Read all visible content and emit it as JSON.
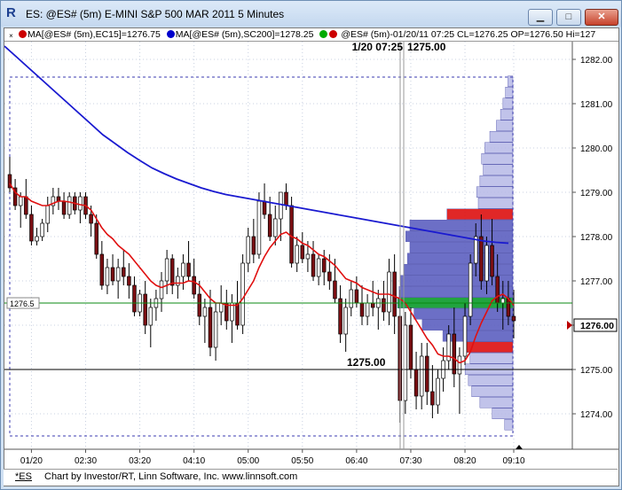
{
  "window": {
    "icon_letter": "R",
    "title": "ES: @ES# (5m) E-MINI S&P 500 MAR 2011 5 Minutes",
    "buttons": {
      "minimize": "▁",
      "maximize": "□",
      "close": "✕"
    }
  },
  "legend": {
    "close_glyph": "×",
    "ma15_text": "MA[@ES# (5m),EC15]=1276.75",
    "ma15_color": "#cc0000",
    "ma200_text": "MA[@ES# (5m),SC200]=1278.25",
    "ma200_color": "#0000cc",
    "bar_text": "@ES# (5m)-01/20/11 07:25 CL=1276.25 OP=1276.50 Hi=127",
    "bar_colors": [
      "#00aa00",
      "#cc0000"
    ]
  },
  "chart_data": {
    "type": "candlestick",
    "x_labels": [
      "01/20",
      "02:30",
      "03:20",
      "04:10",
      "05:00",
      "05:50",
      "06:40",
      "07:30",
      "08:20",
      "09:10"
    ],
    "y_labels": [
      "1282.00",
      "1281.00",
      "1280.00",
      "1279.00",
      "1278.00",
      "1277.00",
      "1276.00",
      "1275.00",
      "1274.00"
    ],
    "ylim": [
      1273.2,
      1282.4
    ],
    "y_ticks": [
      1282,
      1281,
      1280,
      1279,
      1278,
      1277,
      1276,
      1275,
      1274
    ],
    "bars": [
      [
        1279.4,
        1279.8,
        1279.0,
        1279.1
      ],
      [
        1279.1,
        1279.3,
        1278.6,
        1278.7
      ],
      [
        1278.7,
        1279.0,
        1278.2,
        1278.9
      ],
      [
        1278.9,
        1279.3,
        1278.4,
        1278.5
      ],
      [
        1278.5,
        1278.7,
        1277.8,
        1277.9
      ],
      [
        1277.9,
        1278.2,
        1277.8,
        1278.0
      ],
      [
        1278.0,
        1278.4,
        1277.9,
        1278.3
      ],
      [
        1278.3,
        1278.9,
        1278.1,
        1278.7
      ],
      [
        1278.7,
        1279.1,
        1278.5,
        1278.9
      ],
      [
        1278.9,
        1279.1,
        1278.6,
        1278.8
      ],
      [
        1278.8,
        1279.0,
        1278.4,
        1278.5
      ],
      [
        1278.5,
        1279.0,
        1278.4,
        1278.9
      ],
      [
        1278.9,
        1279.0,
        1278.5,
        1278.6
      ],
      [
        1278.6,
        1279.0,
        1278.3,
        1278.9
      ],
      [
        1278.9,
        1279.0,
        1278.4,
        1278.5
      ],
      [
        1278.5,
        1278.7,
        1278.0,
        1278.3
      ],
      [
        1278.3,
        1278.5,
        1277.5,
        1277.6
      ],
      [
        1277.6,
        1277.9,
        1276.8,
        1276.9
      ],
      [
        1276.9,
        1277.5,
        1276.7,
        1277.3
      ],
      [
        1277.3,
        1277.6,
        1276.9,
        1277.0
      ],
      [
        1277.0,
        1277.5,
        1276.6,
        1277.3
      ],
      [
        1277.3,
        1277.7,
        1276.9,
        1277.1
      ],
      [
        1277.1,
        1277.4,
        1276.6,
        1276.9
      ],
      [
        1276.9,
        1277.1,
        1276.2,
        1276.3
      ],
      [
        1276.3,
        1276.8,
        1276.2,
        1276.7
      ],
      [
        1276.7,
        1277.0,
        1275.8,
        1276.0
      ],
      [
        1276.0,
        1276.6,
        1275.5,
        1276.4
      ],
      [
        1276.4,
        1276.8,
        1276.1,
        1276.6
      ],
      [
        1276.6,
        1277.2,
        1276.3,
        1277.0
      ],
      [
        1277.0,
        1277.7,
        1276.7,
        1277.5
      ],
      [
        1277.5,
        1277.6,
        1276.7,
        1276.9
      ],
      [
        1276.9,
        1277.3,
        1276.6,
        1277.1
      ],
      [
        1277.1,
        1277.6,
        1276.8,
        1277.4
      ],
      [
        1277.4,
        1277.9,
        1277.0,
        1277.1
      ],
      [
        1277.1,
        1277.5,
        1276.6,
        1276.7
      ],
      [
        1276.7,
        1277.0,
        1276.0,
        1276.2
      ],
      [
        1276.2,
        1276.6,
        1275.6,
        1276.4
      ],
      [
        1276.4,
        1276.8,
        1275.3,
        1275.5
      ],
      [
        1275.5,
        1276.5,
        1275.2,
        1276.3
      ],
      [
        1276.3,
        1276.9,
        1276.0,
        1276.5
      ],
      [
        1276.5,
        1276.8,
        1275.9,
        1276.1
      ],
      [
        1276.1,
        1276.7,
        1275.6,
        1276.5
      ],
      [
        1276.5,
        1277.0,
        1275.9,
        1276.0
      ],
      [
        1276.0,
        1277.6,
        1275.8,
        1277.4
      ],
      [
        1277.4,
        1278.2,
        1277.2,
        1278.0
      ],
      [
        1278.0,
        1278.4,
        1277.4,
        1277.6
      ],
      [
        1277.6,
        1279.0,
        1277.5,
        1278.8
      ],
      [
        1278.8,
        1279.2,
        1278.4,
        1278.5
      ],
      [
        1278.5,
        1278.9,
        1277.9,
        1278.0
      ],
      [
        1278.0,
        1278.7,
        1277.8,
        1278.4
      ],
      [
        1278.4,
        1279.0,
        1277.9,
        1279.0
      ],
      [
        1279.0,
        1279.2,
        1278.6,
        1278.7
      ],
      [
        1278.7,
        1278.9,
        1277.3,
        1277.4
      ],
      [
        1277.4,
        1278.0,
        1277.2,
        1277.8
      ],
      [
        1277.8,
        1278.1,
        1277.4,
        1277.5
      ],
      [
        1277.5,
        1277.9,
        1277.2,
        1277.6
      ],
      [
        1277.6,
        1277.9,
        1277.0,
        1277.1
      ],
      [
        1277.1,
        1277.6,
        1276.9,
        1277.5
      ],
      [
        1277.5,
        1277.7,
        1276.9,
        1277.2
      ],
      [
        1277.2,
        1277.6,
        1276.8,
        1277.0
      ],
      [
        1277.0,
        1277.5,
        1276.5,
        1276.6
      ],
      [
        1276.6,
        1276.9,
        1275.6,
        1275.8
      ],
      [
        1275.8,
        1276.6,
        1275.4,
        1276.4
      ],
      [
        1276.4,
        1277.0,
        1276.2,
        1276.8
      ],
      [
        1276.8,
        1277.1,
        1276.4,
        1276.5
      ],
      [
        1276.5,
        1276.9,
        1276.0,
        1276.2
      ],
      [
        1276.2,
        1276.7,
        1276.0,
        1276.5
      ],
      [
        1276.5,
        1277.0,
        1276.2,
        1276.4
      ],
      [
        1276.4,
        1276.8,
        1275.9,
        1276.6
      ],
      [
        1276.6,
        1277.0,
        1276.1,
        1276.3
      ],
      [
        1276.3,
        1277.5,
        1276.0,
        1277.2
      ],
      [
        1277.2,
        1277.6,
        1275.8,
        1276.2
      ],
      [
        1276.2,
        1276.8,
        1273.8,
        1274.3
      ],
      [
        1274.3,
        1276.3,
        1274.0,
        1276.0
      ],
      [
        1276.0,
        1276.4,
        1274.8,
        1275.0
      ],
      [
        1275.0,
        1275.4,
        1274.1,
        1274.4
      ],
      [
        1274.4,
        1275.6,
        1274.1,
        1275.3
      ],
      [
        1275.3,
        1275.6,
        1274.2,
        1274.5
      ],
      [
        1274.5,
        1275.1,
        1273.9,
        1274.2
      ],
      [
        1274.2,
        1275.0,
        1274.0,
        1274.8
      ],
      [
        1274.8,
        1275.5,
        1274.5,
        1275.2
      ],
      [
        1275.2,
        1276.0,
        1275.0,
        1275.8
      ],
      [
        1275.8,
        1276.4,
        1274.6,
        1274.9
      ],
      [
        1274.9,
        1275.5,
        1274.0,
        1275.3
      ],
      [
        1275.3,
        1276.5,
        1275.1,
        1276.2
      ],
      [
        1276.2,
        1277.6,
        1276.0,
        1277.4
      ],
      [
        1277.4,
        1278.3,
        1277.1,
        1278.0
      ],
      [
        1278.0,
        1278.5,
        1276.8,
        1277.0
      ],
      [
        1277.0,
        1278.0,
        1276.7,
        1277.8
      ],
      [
        1277.8,
        1278.4,
        1276.9,
        1277.1
      ],
      [
        1277.1,
        1277.6,
        1276.3,
        1276.5
      ],
      [
        1276.5,
        1277.0,
        1275.9,
        1276.6
      ],
      [
        1276.6,
        1277.0,
        1276.0,
        1276.2
      ],
      [
        1276.2,
        1276.8,
        1275.7,
        1276.1
      ]
    ],
    "volume_profile": [
      [
        1281.5,
        6
      ],
      [
        1281.25,
        9
      ],
      [
        1281.0,
        12
      ],
      [
        1280.75,
        15
      ],
      [
        1280.5,
        20
      ],
      [
        1280.25,
        28
      ],
      [
        1280.0,
        34
      ],
      [
        1279.75,
        38
      ],
      [
        1279.5,
        36
      ],
      [
        1279.25,
        40
      ],
      [
        1279.0,
        44
      ],
      [
        1278.75,
        42
      ],
      [
        1278.5,
        80
      ],
      [
        1278.25,
        125
      ],
      [
        1278.0,
        130
      ],
      [
        1277.75,
        125
      ],
      [
        1277.5,
        128
      ],
      [
        1277.25,
        132
      ],
      [
        1277.0,
        136
      ],
      [
        1276.75,
        138
      ],
      [
        1276.5,
        140
      ],
      [
        1276.25,
        120
      ],
      [
        1276.0,
        110
      ],
      [
        1275.75,
        85
      ],
      [
        1275.5,
        60
      ],
      [
        1275.25,
        52
      ],
      [
        1275.0,
        58
      ],
      [
        1274.75,
        54
      ],
      [
        1274.5,
        50
      ],
      [
        1274.25,
        40
      ],
      [
        1274.0,
        25
      ],
      [
        1273.75,
        10
      ]
    ],
    "profile_poc": 1276.5,
    "profile_hi_nodes": [
      1278.5,
      1275.5
    ],
    "ma15": [
      1279.2,
      1279.0,
      1278.9,
      1278.9,
      1278.8,
      1278.75,
      1278.7,
      1278.7,
      1278.75,
      1278.8,
      1278.8,
      1278.78,
      1278.75,
      1278.72,
      1278.7,
      1278.6,
      1278.4,
      1278.2,
      1278.05,
      1277.95,
      1277.8,
      1277.7,
      1277.6,
      1277.45,
      1277.3,
      1277.15,
      1277.0,
      1276.9,
      1276.85,
      1276.9,
      1276.95,
      1276.95,
      1276.95,
      1277.0,
      1276.98,
      1276.9,
      1276.75,
      1276.6,
      1276.5,
      1276.5,
      1276.45,
      1276.45,
      1276.45,
      1276.6,
      1276.8,
      1277.0,
      1277.3,
      1277.55,
      1277.75,
      1277.9,
      1278.05,
      1278.1,
      1278.0,
      1277.95,
      1277.85,
      1277.8,
      1277.7,
      1277.6,
      1277.55,
      1277.45,
      1277.35,
      1277.2,
      1277.05,
      1277.0,
      1276.95,
      1276.85,
      1276.8,
      1276.75,
      1276.7,
      1276.7,
      1276.7,
      1276.65,
      1276.6,
      1276.5,
      1276.3,
      1276.1,
      1275.9,
      1275.7,
      1275.55,
      1275.35,
      1275.3,
      1275.3,
      1275.25,
      1275.15,
      1275.2,
      1275.4,
      1275.75,
      1276.05,
      1276.3,
      1276.55,
      1276.65,
      1276.7,
      1276.6,
      1276.45
    ],
    "ma200": [
      1282.3,
      1282.05,
      1281.8,
      1281.55,
      1281.3,
      1281.05,
      1280.8,
      1280.55,
      1280.3,
      1280.1,
      1279.9,
      1279.72,
      1279.55,
      1279.42,
      1279.3,
      1279.2,
      1279.1,
      1279.02,
      1278.95,
      1278.9,
      1278.85,
      1278.8,
      1278.75,
      1278.7,
      1278.65,
      1278.6,
      1278.55,
      1278.5,
      1278.45,
      1278.4,
      1278.35,
      1278.3,
      1278.25,
      1278.2,
      1278.15,
      1278.1,
      1278.05,
      1278.0,
      1277.95,
      1277.9,
      1277.87,
      1277.85
    ],
    "ma200_colors": {
      "line": "#1a1ad0"
    },
    "current_price": "1276.00",
    "cursor_line_label": "1276.5",
    "cursor_line_value": 1276.5,
    "ref_line_label": "1275.00",
    "ref_line_value": 1275.0,
    "crosshair_label": "1/20 07:25",
    "crosshair_price": "1275.00",
    "colors": {
      "up": "#ffffff",
      "down": "#7a0e12",
      "ma15": "#e01010",
      "ma200": "#1a1ad0",
      "profile": "#5c5fc0",
      "profile_light": "#b6b9e6",
      "poc": "#0a9a2a",
      "hvn": "#dd1010",
      "grid": "#c8d0e0",
      "green_line": "#0a8a10"
    }
  },
  "footer": {
    "symbol": "*ES",
    "credit": "Chart by Investor/RT, Linn Software, Inc. www.linnsoft.com"
  }
}
